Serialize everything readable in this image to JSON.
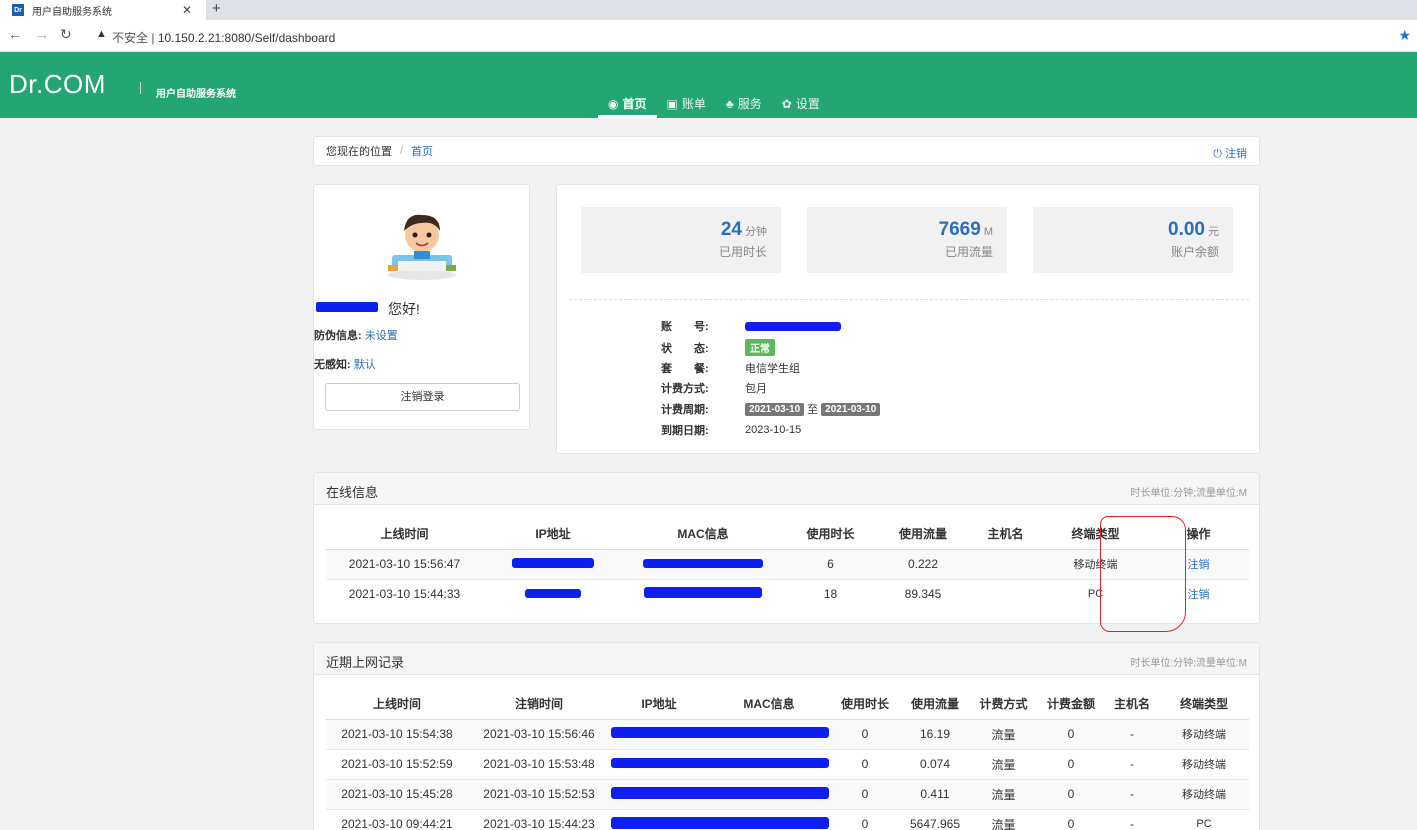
{
  "browser": {
    "tab_title": "用户自助服务系统",
    "favicon_text": "Dr",
    "address_warning": "不安全",
    "url": "10.150.2.21:8080/Self/dashboard"
  },
  "header": {
    "logo": "Dr.COM",
    "subtitle": "用户自助服务系统",
    "nav": [
      {
        "label": "首页",
        "icon": "dashboard-icon",
        "active": true
      },
      {
        "label": "账单",
        "icon": "bill-icon",
        "active": false
      },
      {
        "label": "服务",
        "icon": "service-icon",
        "active": false
      },
      {
        "label": "设置",
        "icon": "gear-icon",
        "active": false
      }
    ]
  },
  "breadcrumb": {
    "prefix": "您现在的位置",
    "separator": "/",
    "current": "首页",
    "logout": "注销"
  },
  "profile": {
    "greeting": "您好!",
    "anti_fraud_label": "防伪信息:",
    "anti_fraud_value": "未设置",
    "seamless_label": "无感知:",
    "seamless_value": "默认",
    "logout_button": "注销登录"
  },
  "stats": [
    {
      "value": "24",
      "unit": "分钟",
      "label": "已用时长"
    },
    {
      "value": "7669",
      "unit": "M",
      "label": "已用流量"
    },
    {
      "value": "0.00",
      "unit": "元",
      "label": "账户余额"
    }
  ],
  "account": {
    "account_label": "账　　号:",
    "status_label": "状　　态:",
    "status_value": "正常",
    "package_label": "套　　餐:",
    "package_value": "电信学生组",
    "billing_label": "计费方式:",
    "billing_value": "包月",
    "period_label": "计费周期:",
    "period_start": "2021-03-10",
    "period_to": "至",
    "period_end": "2021-03-10",
    "expire_label": "到期日期:",
    "expire_value": "2023-10-15"
  },
  "online": {
    "title": "在线信息",
    "note": "时长单位:分钟;流量单位:M",
    "headers": [
      "上线时间",
      "IP地址",
      "MAC信息",
      "使用时长",
      "使用流量",
      "主机名",
      "终端类型",
      "操作"
    ],
    "rows": [
      {
        "time": "2021-03-10 15:56:47",
        "duration": "6",
        "traffic": "0.222",
        "host": "",
        "terminal": "移动终端",
        "action": "注销"
      },
      {
        "time": "2021-03-10 15:44:33",
        "duration": "18",
        "traffic": "89.345",
        "host": "",
        "terminal": "PC",
        "action": "注销"
      }
    ]
  },
  "records": {
    "title": "近期上网记录",
    "note": "时长单位:分钟;流量单位:M",
    "headers": [
      "上线时间",
      "注销时间",
      "IP地址",
      "MAC信息",
      "使用时长",
      "使用流量",
      "计费方式",
      "计费金额",
      "主机名",
      "终端类型"
    ],
    "rows": [
      {
        "on": "2021-03-10 15:54:38",
        "off": "2021-03-10 15:56:46",
        "duration": "0",
        "traffic": "16.19",
        "billing": "流量",
        "amount": "0",
        "host": "-",
        "terminal": "移动终端"
      },
      {
        "on": "2021-03-10 15:52:59",
        "off": "2021-03-10 15:53:48",
        "duration": "0",
        "traffic": "0.074",
        "billing": "流量",
        "amount": "0",
        "host": "-",
        "terminal": "移动终端"
      },
      {
        "on": "2021-03-10 15:45:28",
        "off": "2021-03-10 15:52:53",
        "duration": "0",
        "traffic": "0.411",
        "billing": "流量",
        "amount": "0",
        "host": "-",
        "terminal": "移动终端"
      },
      {
        "on": "2021-03-10 09:44:21",
        "off": "2021-03-10 15:44:23",
        "duration": "0",
        "traffic": "5647.965",
        "billing": "流量",
        "amount": "0",
        "host": "-",
        "terminal": "PC"
      }
    ]
  },
  "colors": {
    "header_green": "#23a674",
    "link_blue": "#2a6ebb",
    "redaction_blue": "#0f1ff0",
    "annotation_red": "#e02020"
  }
}
